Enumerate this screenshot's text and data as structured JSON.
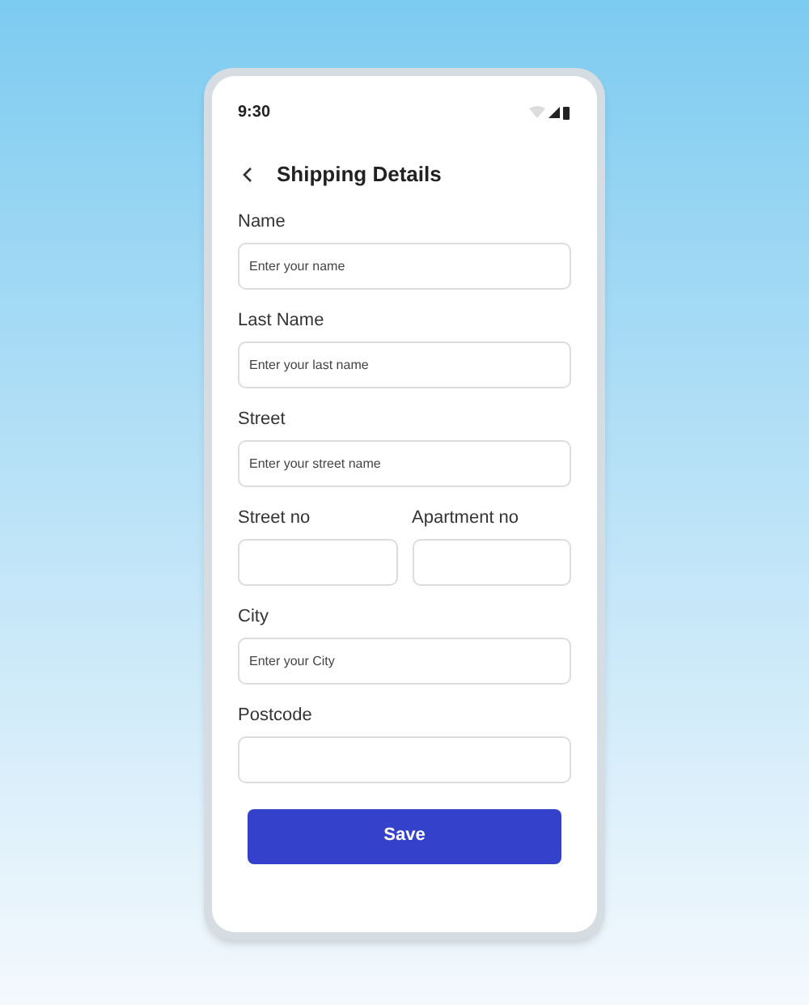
{
  "status_bar": {
    "time": "9:30"
  },
  "header": {
    "title": "Shipping Details"
  },
  "rows": [
    {
      "fields": [
        {
          "label": "Name",
          "placeholder": "Enter your name"
        }
      ]
    },
    {
      "fields": [
        {
          "label": "Last Name",
          "placeholder": "Enter your last name"
        }
      ]
    },
    {
      "fields": [
        {
          "label": "Street",
          "placeholder": "Enter your street name"
        }
      ]
    },
    {
      "fields": [
        {
          "label": "Street no"
        },
        {
          "label": "Apartment no"
        }
      ]
    },
    {
      "fields": [
        {
          "label": "City",
          "placeholder": "Enter your City"
        }
      ]
    },
    {
      "fields": [
        {
          "label": "Postcode"
        }
      ]
    }
  ],
  "save_button": "Save"
}
